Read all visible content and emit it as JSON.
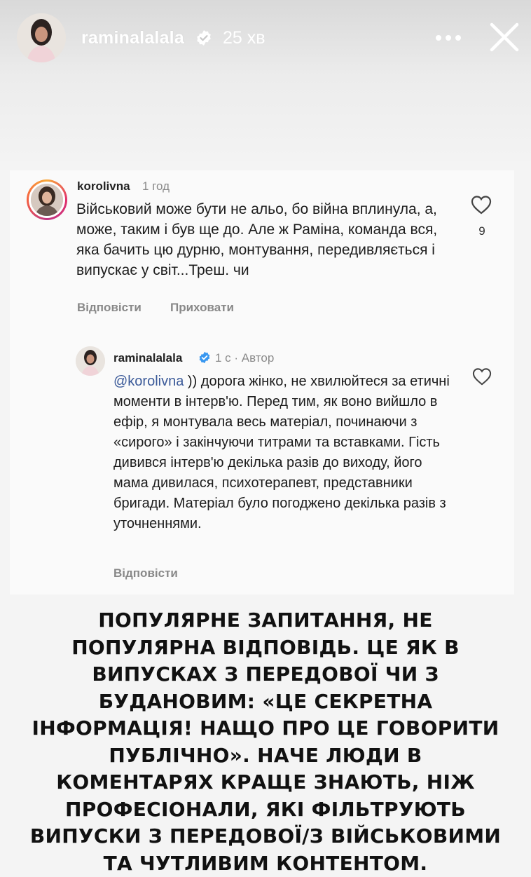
{
  "story": {
    "username": "raminalalala",
    "time": "25 хв"
  },
  "comment": {
    "username": "korolivna",
    "time": "1 год",
    "text": "Військовий може бути не альо, бо війна вплинула, а, може, таким і був ще до. Але ж Раміна, команда вся, яка бачить цю дурню, монтування, передивляється і випускає у світ...Треш. чи",
    "likes": "9",
    "reply_label": "Відповісти",
    "hide_label": "Приховати"
  },
  "reply": {
    "username": "raminalalala",
    "meta": "1 с · Автор",
    "mention": "@korolivna",
    "text": ")) дорога жінко, не хвилюйтеся за етичні моменти в інтерв'ю. Перед тим, як воно вийшло в ефір, я монтувала весь матеріал, починаючи з «сирого» і закінчуючи титрами та вставками. Гість дивився інтерв'ю декілька разів до виходу, його мама дивилася, психотерапевт, представники бригади. Матеріал було погоджено декілька разів з уточненнями.",
    "reply_label": "Відповісти"
  },
  "caption": "ПОПУЛЯРНЕ ЗАПИТАННЯ, НЕ ПОПУЛЯРНА ВІДПОВІДЬ. ЦЕ ЯК В ВИПУСКАХ З ПЕРЕДОВОЇ ЧИ З БУДАНОВИМ: «ЦЕ СЕКРЕТНА ІНФОРМАЦІЯ! НАЩО ПРО ЦЕ ГОВОРИТИ ПУБЛІЧНО». НАЧЕ ЛЮДИ В КОМЕНТАРЯХ КРАЩЕ ЗНАЮТЬ, НІЖ ПРОФЕСІОНАЛИ, ЯКІ ФІЛЬТРУЮТЬ ВИПУСКИ З ПЕРЕДОВОЇ/З ВІЙСЬКОВИМИ ТА ЧУТЛИВИМ КОНТЕНТОМ.",
  "colors": {
    "verified": "#3897f0",
    "mention": "#3b5a99",
    "story_ring_start": "#f9a93a",
    "story_ring_end": "#c13584"
  },
  "icons": [
    "verified-badge-icon",
    "more-options-icon",
    "close-icon",
    "heart-icon"
  ]
}
